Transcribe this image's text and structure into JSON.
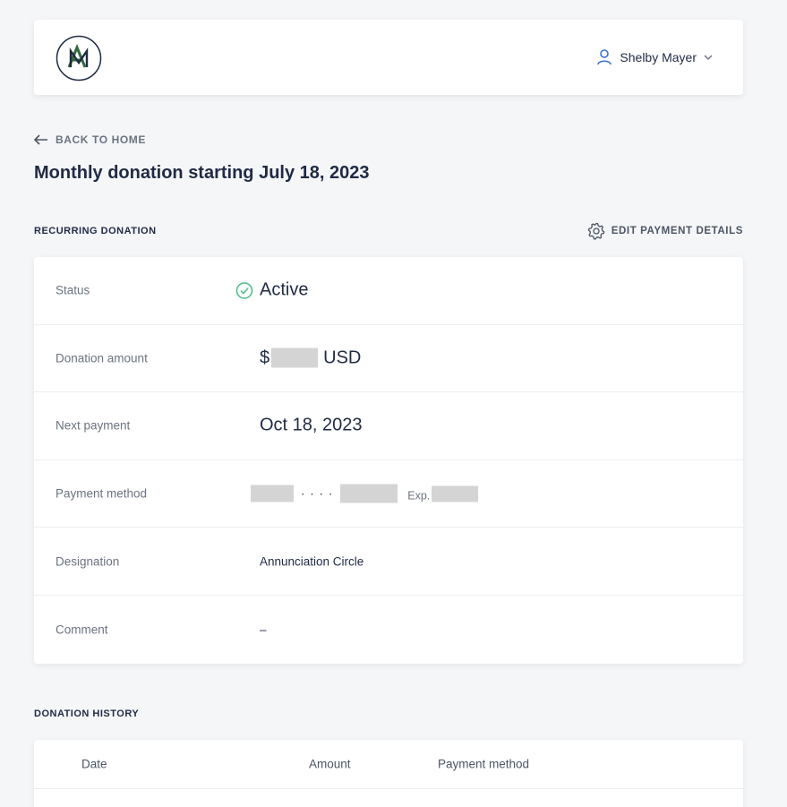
{
  "header": {
    "logo_letters": "AM",
    "user_name": "Shelby Mayer"
  },
  "nav": {
    "back_label": "BACK TO HOME"
  },
  "page": {
    "title": "Monthly donation starting July 18, 2023"
  },
  "recurring": {
    "section_label": "RECURRING DONATION",
    "edit_label": "EDIT PAYMENT DETAILS",
    "rows": [
      {
        "key": "Status",
        "value": "Active"
      },
      {
        "key": "Donation amount",
        "currency_symbol": "$",
        "currency_code": "USD"
      },
      {
        "key": "Next payment",
        "value": "Oct 18, 2023"
      },
      {
        "key": "Payment method",
        "dots": "· · · ·",
        "exp_label": "Exp."
      },
      {
        "key": "Designation",
        "value": "Annunciation Circle"
      },
      {
        "key": "Comment",
        "value": "–"
      }
    ]
  },
  "history": {
    "section_label": "DONATION HISTORY",
    "columns": [
      "Date",
      "Amount",
      "Payment method"
    ]
  },
  "colors": {
    "accent": "#3b6fd8",
    "success": "#4cbb87",
    "logo_green": "#2f6b3d",
    "logo_navy": "#1f2a44"
  }
}
